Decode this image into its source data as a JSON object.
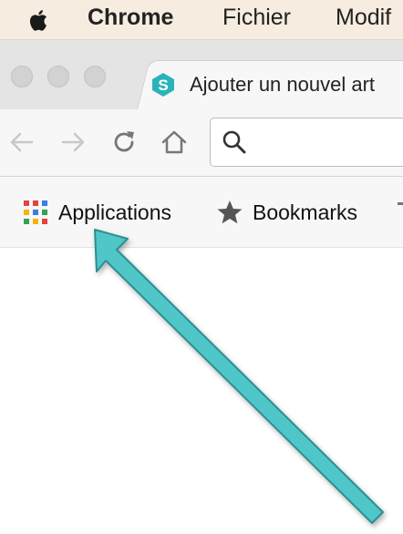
{
  "menubar": {
    "app_name": "Chrome",
    "items": [
      "Fichier",
      "Modif"
    ],
    "apple_icon": "apple-logo-icon"
  },
  "tab": {
    "title": "Ajouter un nouvel art",
    "favicon_letter": "S",
    "favicon_color": "#2bb3b9"
  },
  "toolbar": {
    "icons": [
      "back-arrow-icon",
      "forward-arrow-icon",
      "reload-icon",
      "home-icon",
      "search-icon"
    ],
    "omnibox_value": ""
  },
  "bookmarks": {
    "items": [
      {
        "label": "Applications",
        "icon": "apps-grid-icon"
      },
      {
        "label": "Bookmarks",
        "icon": "star-icon"
      }
    ]
  },
  "annotation": {
    "arrow_color": "#4fc7c9",
    "arrow_stroke": "#2e8e91"
  }
}
